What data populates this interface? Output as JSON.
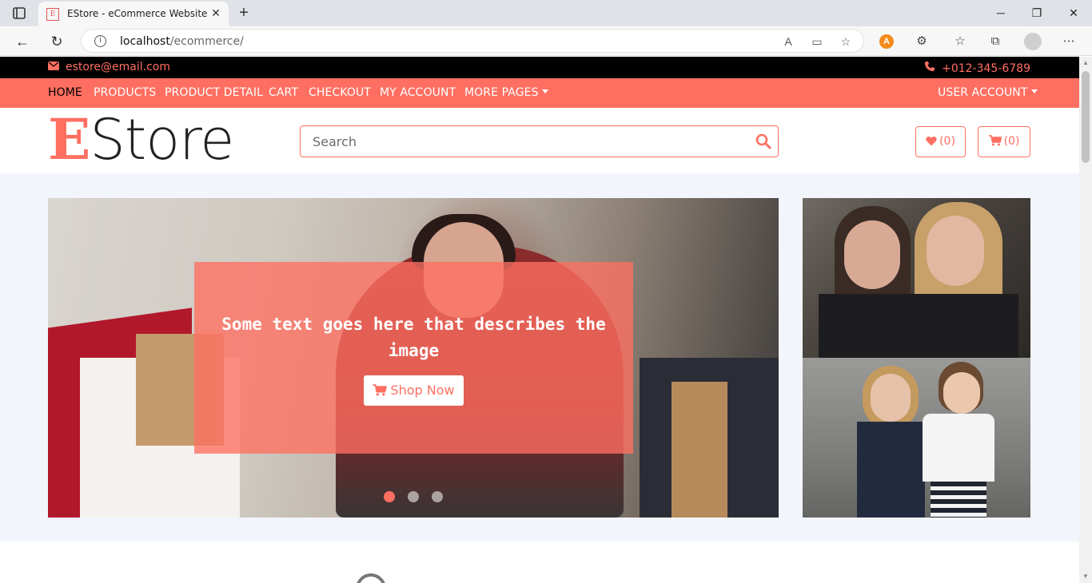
{
  "browser": {
    "tab_title": "EStore - eCommerce Website",
    "favicon_text": "EStore",
    "address_host": "localhost",
    "address_path": "/ecommerce/"
  },
  "topbar": {
    "email": "estore@email.com",
    "phone": "+012-345-6789"
  },
  "nav": {
    "items": [
      {
        "label": "HOME"
      },
      {
        "label": "PRODUCTS"
      },
      {
        "label": "PRODUCT DETAIL"
      },
      {
        "label": "CART"
      },
      {
        "label": "CHECKOUT"
      },
      {
        "label": "MY ACCOUNT"
      },
      {
        "label": "MORE PAGES"
      }
    ],
    "user_account": "USER ACCOUNT"
  },
  "header": {
    "logo_first": "E",
    "logo_rest": "Store",
    "search_placeholder": "Search",
    "wishlist_count": "(0)",
    "cart_count": "(0)"
  },
  "hero": {
    "caption": "Some text goes here that describes the image",
    "button_label": "Shop Now",
    "slide_count": 3,
    "active_slide": 1
  },
  "colors": {
    "accent": "#ff6f61",
    "topbar_bg": "#000000",
    "hero_bg": "#f2f5fc"
  },
  "icons": {
    "email": "envelope-icon",
    "phone": "phone-icon",
    "search": "search-icon",
    "wishlist": "heart-icon",
    "cart": "cart-icon"
  }
}
